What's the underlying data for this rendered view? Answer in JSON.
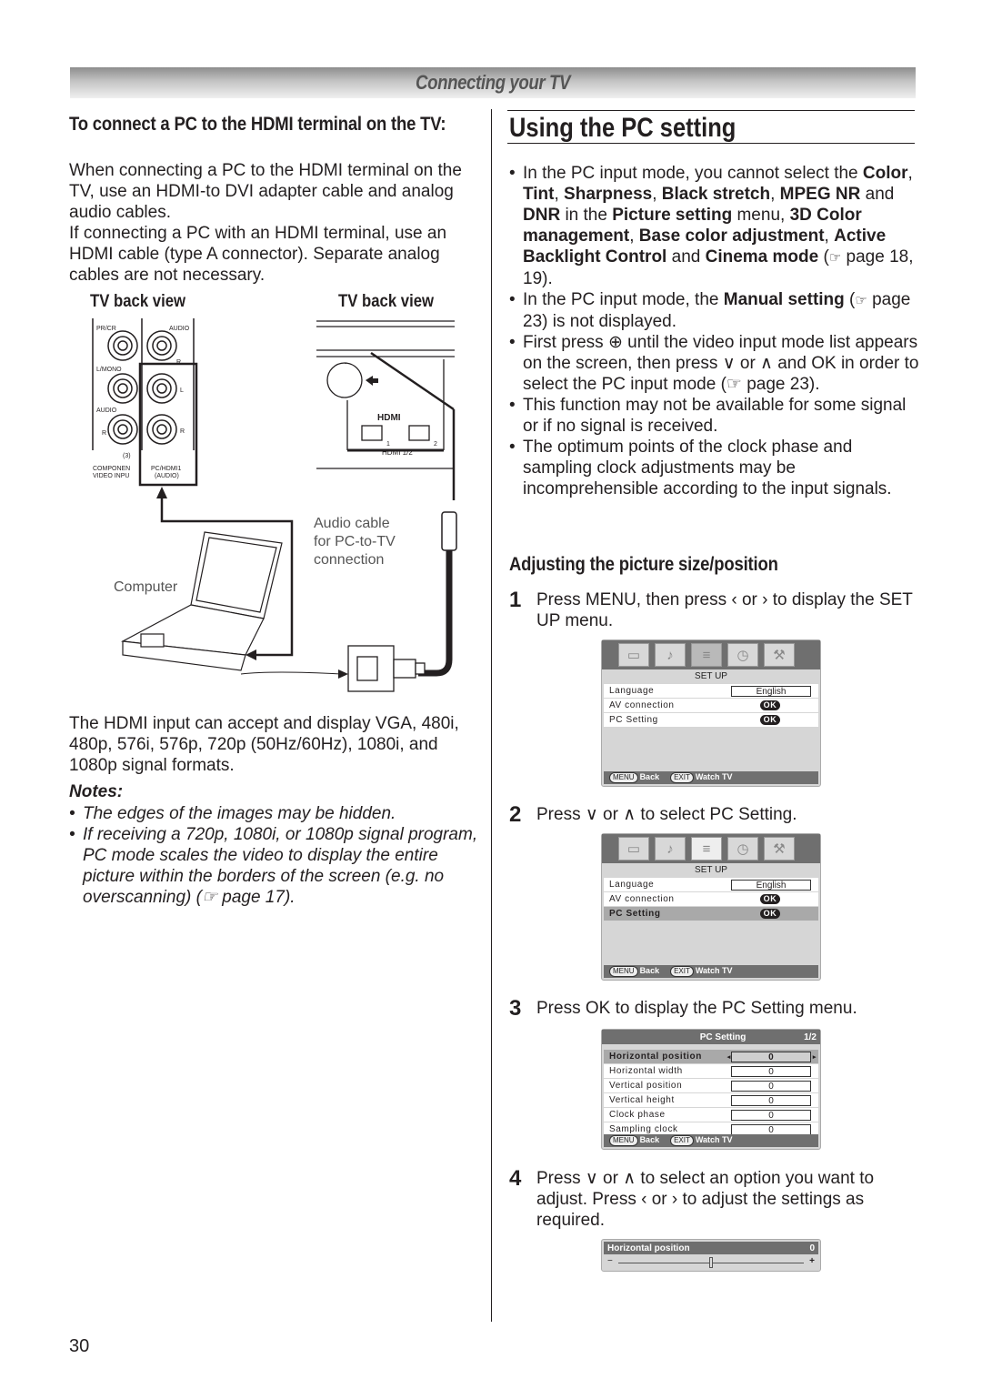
{
  "header": {
    "section_title": "Connecting your TV"
  },
  "left": {
    "heading": "To connect a PC to the HDMI terminal on the TV:",
    "para1": "When connecting a PC to the HDMI terminal on the TV, use an HDMI-to DVI adapter cable and analog audio cables.",
    "para2": "If connecting a PC with an HDMI terminal, use an HDMI cable (type A connector). Separate analog cables are not necessary.",
    "diagram": {
      "tv_back_view_left": "TV back view",
      "tv_back_view_right": "TV back view",
      "jack_labels": [
        "PR/CR",
        "AUDIO",
        "R",
        "L/MONO",
        "L",
        "AUDIO",
        "R",
        "R",
        "(3)",
        "COMPONENT VIDEO INPUT",
        "PC/HDMI1 (AUDIO)"
      ],
      "hdmi_logo": "HDMI",
      "hdmi_port_numbers": [
        "1",
        "2"
      ],
      "hdmi_label": "HDMI 1/2",
      "audio_cable_label": "Audio cable for PC-to-TV connection",
      "computer_label": "Computer"
    },
    "para3": "The HDMI input can accept and display VGA, 480i, 480p, 576i, 576p, 720p (50Hz/60Hz), 1080i, and 1080p signal formats.",
    "notes_title": "Notes:",
    "notes": [
      "The edges of the images may be hidden.",
      "If receiving a 720p, 1080i, or 1080p signal program, PC mode scales the video to display the entire picture within the borders of the screen (e.g. no overscanning) (☞ page 17)."
    ]
  },
  "right": {
    "title": "Using the PC setting",
    "bullets": {
      "b1_intro": "In the PC input mode, you cannot select the",
      "b1_terms": [
        "Color",
        "Tint",
        "Sharpness",
        "Black stretch",
        "MPEG NR",
        "DNR",
        "Picture setting",
        "3D Color management",
        "Base color adjustment",
        "Active Backlight Control",
        "Cinema mode"
      ],
      "b1_ref": "page 18, 19",
      "b2_text": "In the PC input mode, the",
      "b2_term": "Manual setting",
      "b2_ref": "page 23",
      "b2_tail": "is not displayed.",
      "b3": "First press ⊕ until the video input mode list appears on the screen, then press ∨ or ∧ and OK in order to select the PC input mode (☞ page 23).",
      "b4": "This function may not be available for some signal or if no signal is received.",
      "b5": "The optimum points of the clock phase and sampling clock adjustments may be incomprehensible according to the input signals."
    },
    "subheading": "Adjusting the picture size/position",
    "steps": [
      {
        "num": "1",
        "text": "Press MENU, then press ‹ or › to display the SET UP menu."
      },
      {
        "num": "2",
        "text": "Press ∨ or ∧ to select PC Setting."
      },
      {
        "num": "3",
        "text": "Press OK to display the PC Setting menu."
      },
      {
        "num": "4",
        "text": "Press ∨ or ∧ to select an option you want to adjust. Press ‹ or › to adjust the settings as required."
      }
    ],
    "osd_setup": {
      "title": "SET UP",
      "rows": [
        {
          "label": "Language",
          "value": "English"
        },
        {
          "label": "AV connection",
          "value": "OK"
        },
        {
          "label": "PC Setting",
          "value": "OK"
        }
      ],
      "footer_back_key": "MENU",
      "footer_back": "Back",
      "footer_exit_key": "EXIT",
      "footer_exit": "Watch TV"
    },
    "osd_pc": {
      "title": "PC Setting",
      "page": "1/2",
      "rows": [
        {
          "label": "Horizontal position",
          "value": "0"
        },
        {
          "label": "Horizontal width",
          "value": "0"
        },
        {
          "label": "Vertical position",
          "value": "0"
        },
        {
          "label": "Vertical height",
          "value": "0"
        },
        {
          "label": "Clock phase",
          "value": "0"
        },
        {
          "label": "Sampling clock",
          "value": "0"
        }
      ]
    },
    "osd_slider": {
      "label": "Horizontal position",
      "value": "0",
      "minus": "−",
      "plus": "+",
      "position_fraction": 0.5
    }
  },
  "footer": {
    "page_number": "30"
  }
}
